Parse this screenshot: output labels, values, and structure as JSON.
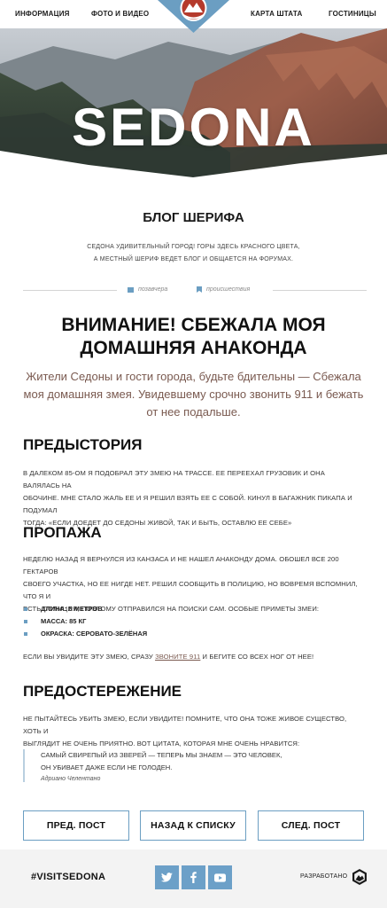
{
  "nav": {
    "items": [
      "ИНФОРМАЦИЯ",
      "ФОТО И ВИДЕО",
      "КАРТА ШТАТА",
      "ГОСТИНИЦЫ"
    ],
    "logo_text": "CITY OF SEDONA"
  },
  "hero": {
    "title": "SEDONA"
  },
  "blog": {
    "title": "БЛОГ ШЕРИФА",
    "description": [
      "СЕДОНА УДИВИТЕЛЬНЫЙ ГОРОД! ГОРЫ ЗДЕСЬ КРАСНОГО ЦВЕТА,",
      "А МЕСТНЫЙ ШЕРИФ ВЕДЕТ БЛОГ И ОБЩАЕТСЯ НА ФОРУМАХ."
    ]
  },
  "meta": {
    "date": "позавчера",
    "category": "происшествия",
    "date_icon": "calendar-icon",
    "category_icon": "bookmark-icon"
  },
  "article": {
    "headline_lines": [
      "ВНИМАНИЕ! СБЕЖАЛА МОЯ",
      "ДОМАШНЯЯ АНАКОНДА"
    ],
    "lead_lines": [
      "Жители Седоны и гости города, будьте бдительны — Сбежала",
      "моя домашняя змея. Увидевшему срочно звонить 911 и бежать",
      "от нее подальше."
    ],
    "sections": {
      "background": {
        "title": "ПРЕДЫСТОРИЯ",
        "lines": [
          "В ДАЛЕКОМ 85-ОМ Я ПОДОБРАЛ ЭТУ ЗМЕЮ НА ТРАССЕ. ЕЕ ПЕРЕЕХАЛ ГРУЗОВИК И ОНА ВАЛЯЛАСЬ НА",
          "ОБОЧИНЕ. МНЕ СТАЛО ЖАЛЬ ЕЕ И Я РЕШИЛ ВЗЯТЬ ЕЕ С СОБОЙ. КИНУЛ В БАГАЖНИК ПИКАПА И ПОДУМАЛ",
          "ТОГДА: «ЕСЛИ ДОЕДЕТ ДО СЕДОНЫ ЖИВОЙ, ТАК И БЫТЬ, ОСТАВЛЮ ЕЕ СЕБЕ»"
        ]
      },
      "loss": {
        "title": "ПРОПАЖА",
        "lines": [
          "НЕДЕЛЮ НАЗАД Я ВЕРНУЛСЯ ИЗ КАНЗАСА И НЕ НАШЕЛ АНАКОНДУ ДОМА. ОБОШЕЛ ВСЕ 200 ГЕКТАРОВ",
          "СВОЕГО УЧАСТКА, НО ЕЕ НИГДЕ НЕТ. РЕШИЛ СООБЩИТЬ В ПОЛИЦИЮ, НО ВОВРЕМЯ ВСПОМНИЛ, ЧТО Я И",
          "ЕСТЬ ПОЛИЦИЯ, ПОЭТОМУ ОТПРАВИЛСЯ НА ПОИСКИ САМ. ОСОБЫЕ ПРИМЕТЫ ЗМЕИ:"
        ],
        "bullets": [
          "ДЛИНА: 5 МЕТРОВ",
          "МАССА: 85 КГ",
          "ОКРАСКА: СЕРОВАТО-ЗЕЛЁНАЯ"
        ],
        "call_before": "ЕСЛИ ВЫ УВИДИТЕ ЭТУ ЗМЕЮ, СРАЗУ ",
        "call_link": "ЗВОНИТЕ 911",
        "call_after": " И БЕГИТЕ СО ВСЕХ НОГ ОТ НЕЕ!"
      },
      "warning": {
        "title": "ПРЕДОСТЕРЕЖЕНИЕ",
        "lines": [
          "НЕ ПЫТАЙТЕСЬ УБИТЬ ЗМЕЮ, ЕСЛИ УВИДИТЕ! ПОМНИТЕ, ЧТО ОНА ТОЖЕ ЖИВОЕ СУЩЕСТВО, ХОТЬ И",
          "ВЫГЛЯДИТ НЕ ОЧЕНЬ ПРИЯТНО. ВОТ ЦИТАТА, КОТОРАЯ МНЕ ОЧЕНЬ НРАВИТСЯ:"
        ],
        "quote_lines": [
          "САМЫЙ СВИРЕПЫЙ ИЗ ЗВЕРЕЙ — ТЕПЕРЬ МЫ ЗНАЕМ — ЭТО ЧЕЛОВЕК,",
          "ОН УБИВАЕТ ДАЖЕ ЕСЛИ НЕ ГОЛОДЕН."
        ],
        "quote_author": "Адриано Челентано"
      }
    }
  },
  "buttons": {
    "prev": "ПРЕД. ПОСТ",
    "back": "НАЗАД К СПИСКУ",
    "next": "СЛЕД. ПОСТ"
  },
  "footer": {
    "hashtag": "#VISITSEDONA",
    "social": [
      "twitter-icon",
      "facebook-icon",
      "youtube-icon"
    ],
    "developed_by": "РАЗРАБОТАНО"
  },
  "colors": {
    "accent": "#6b9ec2",
    "lead": "#7a5a50",
    "footer_bg": "#f3f3f3",
    "logo_red": "#b53a2c"
  }
}
